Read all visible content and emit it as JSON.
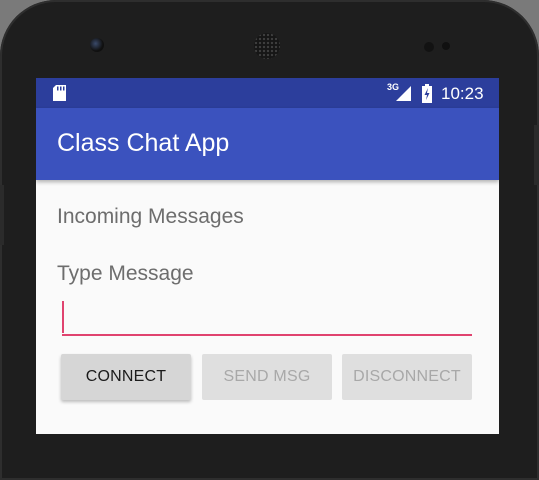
{
  "status_bar": {
    "network_type": "3G",
    "time": "10:23",
    "icons": [
      "sd-card-icon",
      "cell-signal-icon",
      "battery-charging-icon"
    ]
  },
  "app_bar": {
    "title": "Class Chat App",
    "color": "#3b52be"
  },
  "content": {
    "incoming_label": "Incoming Messages",
    "type_label": "Type Message",
    "message_input": {
      "value": "",
      "placeholder": ""
    },
    "accent_color": "#e0436f"
  },
  "buttons": {
    "connect": "CONNECT",
    "send": "SEND MSG",
    "disconnect": "DISCONNECT"
  },
  "colors": {
    "status_bar": "#2c3e9c",
    "background": "#fafafa"
  }
}
